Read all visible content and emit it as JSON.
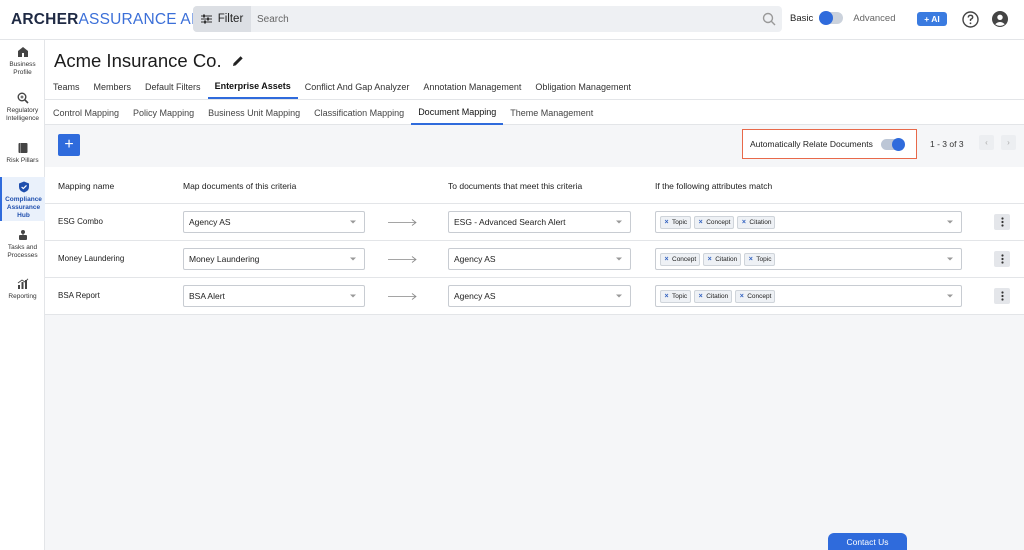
{
  "app": {
    "logo_archer": "ARCHER",
    "logo_assurance": "ASSURANCE AI"
  },
  "search": {
    "filter_label": "Filter",
    "placeholder": "Search"
  },
  "mode": {
    "basic": "Basic",
    "advanced": "Advanced"
  },
  "ai_button": "+ AI",
  "sidebar": {
    "items": [
      {
        "label": "Business Profile",
        "icon": "building-icon"
      },
      {
        "label": "Regulatory Intelligence",
        "icon": "search-zoom-icon"
      },
      {
        "label": "Risk Pillars",
        "icon": "book-icon"
      },
      {
        "label": "Compliance Assurance Hub",
        "icon": "shield-check-icon",
        "active": true
      },
      {
        "label": "Tasks and Processes",
        "icon": "tasks-icon"
      },
      {
        "label": "Reporting",
        "icon": "chart-icon"
      }
    ]
  },
  "page": {
    "title": "Acme Insurance Co."
  },
  "tabs_primary": [
    "Teams",
    "Members",
    "Default Filters",
    "Enterprise Assets",
    "Conflict And Gap Analyzer",
    "Annotation Management",
    "Obligation Management"
  ],
  "tabs_primary_active": "Enterprise Assets",
  "tabs_secondary": [
    "Control Mapping",
    "Policy Mapping",
    "Business Unit Mapping",
    "Classification Mapping",
    "Document Mapping",
    "Theme Management"
  ],
  "tabs_secondary_active": "Document Mapping",
  "toolbar": {
    "add_label": "+",
    "auto_relate_label": "Automatically Relate Documents",
    "auto_relate_on": true,
    "pager_text": "1 - 3 of 3"
  },
  "table": {
    "headers": [
      "Mapping name",
      "Map documents of this criteria",
      "To documents that meet this criteria",
      "If the following attributes match"
    ],
    "rows": [
      {
        "name": "ESG Combo",
        "source": "Agency AS",
        "target": "ESG - Advanced Search Alert",
        "attributes": [
          "Topic",
          "Concept",
          "Citation"
        ]
      },
      {
        "name": "Money Laundering",
        "source": "Money Laundering",
        "target": "Agency AS",
        "attributes": [
          "Concept",
          "Citation",
          "Topic"
        ]
      },
      {
        "name": "BSA Report",
        "source": "BSA Alert",
        "target": "Agency AS",
        "attributes": [
          "Topic",
          "Citation",
          "Concept"
        ]
      }
    ]
  },
  "contact_label": "Contact Us",
  "colors": {
    "accent": "#2f6bdc",
    "highlight_border": "#e8694a"
  }
}
